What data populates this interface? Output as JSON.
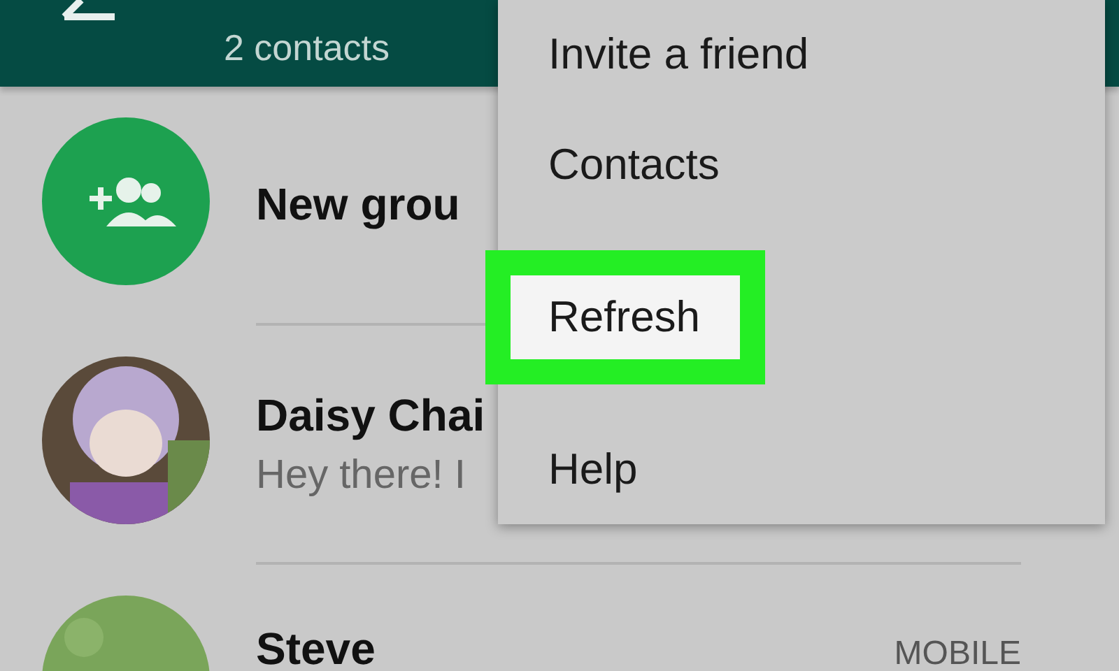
{
  "header": {
    "subtitle": "2 contacts"
  },
  "contacts": [
    {
      "kind": "group",
      "name": "New grou"
    },
    {
      "kind": "contact",
      "name": "Daisy Chai",
      "status": "Hey there! I"
    },
    {
      "kind": "contact",
      "name": "Steve",
      "label": "MOBILE"
    }
  ],
  "menu": {
    "items": [
      {
        "label": "Invite a friend",
        "highlighted": false
      },
      {
        "label": "Contacts",
        "highlighted": false
      },
      {
        "label": "Refresh",
        "highlighted": true
      },
      {
        "label": "Help",
        "highlighted": false
      }
    ]
  }
}
